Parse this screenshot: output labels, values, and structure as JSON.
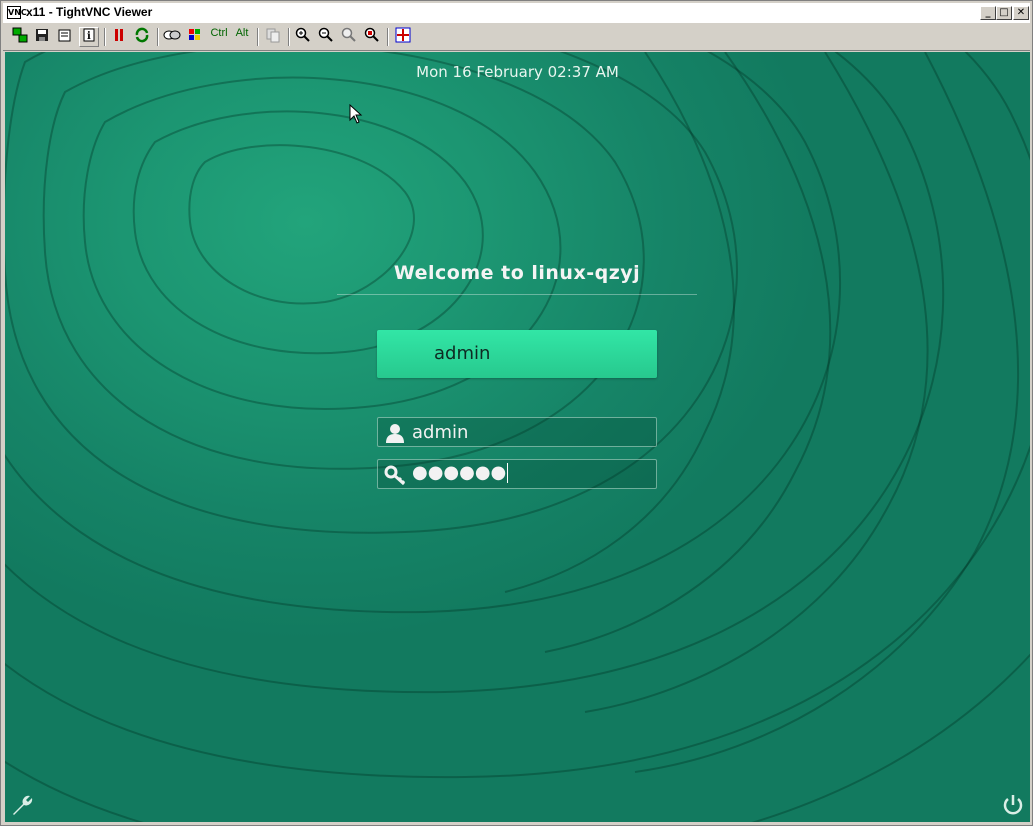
{
  "window": {
    "title": "x11 - TightVNC Viewer",
    "icon_text": "VNC",
    "buttons": {
      "minimize": "_",
      "maximize": "□",
      "close": "✕"
    }
  },
  "toolbar": {
    "items": [
      {
        "icon": "new-connection-icon"
      },
      {
        "icon": "save-icon"
      },
      {
        "icon": "options-icon"
      },
      {
        "icon": "info-icon"
      },
      {
        "icon": "pause-icon"
      },
      {
        "icon": "refresh-icon"
      },
      {
        "icon": "ctrl-alt-del-icon"
      },
      {
        "icon": "ctrl-esc-icon"
      },
      {
        "icon": "clipboard-icon"
      },
      {
        "icon": "zoom-in-icon"
      },
      {
        "icon": "zoom-out-icon"
      },
      {
        "icon": "zoom-100-icon"
      },
      {
        "icon": "zoom-auto-icon"
      },
      {
        "icon": "fullscreen-icon"
      }
    ],
    "ctrl_label": "Ctrl",
    "alt_label": "Alt"
  },
  "login": {
    "clock": "Mon 16 February 02:37 AM",
    "welcome": "Welcome to linux-qzyj",
    "user_tile": "admin",
    "username_value": "admin",
    "password_mask": "●●●●●●",
    "accent": "#2fe0a2",
    "background": "#168467"
  },
  "bottom": {
    "settings_icon": "wrench-icon",
    "power_icon": "power-icon"
  }
}
